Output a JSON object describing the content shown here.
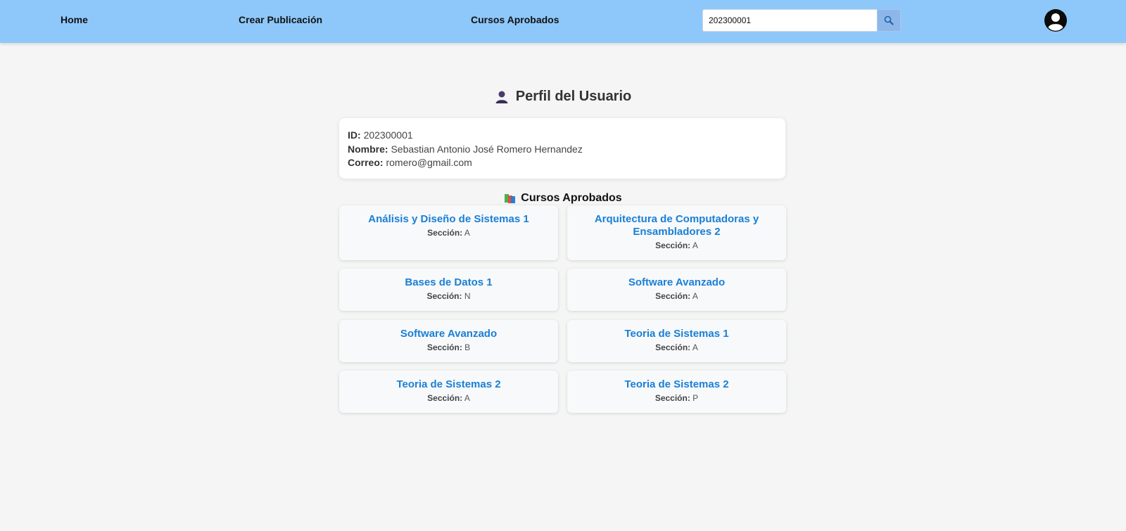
{
  "nav": {
    "home": "Home",
    "create_post": "Crear Publicación",
    "approved_courses": "Cursos Aprobados"
  },
  "search": {
    "value": "202300001",
    "placeholder": "",
    "button_icon": "search-icon"
  },
  "user_menu": {
    "icon": "user-avatar-icon"
  },
  "profile": {
    "title": "Perfil del Usuario",
    "title_icon": "user-silhouette-icon",
    "id_label": "ID:",
    "id_value": "202300001",
    "name_label": "Nombre:",
    "name_value": "Sebastian Antonio José Romero Hernandez",
    "email_label": "Correo:",
    "email_value": "romero@gmail.com"
  },
  "courses": {
    "title": "Cursos Aprobados",
    "title_icon": "books-icon",
    "section_label": "Sección:",
    "items": [
      {
        "name": "Análisis y Diseño de Sistemas 1",
        "section": "A"
      },
      {
        "name": "Arquitectura de Computadoras y Ensambladores 2",
        "section": "A"
      },
      {
        "name": "Bases de Datos 1",
        "section": "N"
      },
      {
        "name": "Software Avanzado",
        "section": "A"
      },
      {
        "name": "Software Avanzado",
        "section": "B"
      },
      {
        "name": "Teoria de Sistemas 1",
        "section": "A"
      },
      {
        "name": "Teoria de Sistemas 2",
        "section": "A"
      },
      {
        "name": "Teoria de Sistemas 2",
        "section": "P"
      }
    ]
  },
  "colors": {
    "navbar": "#8ec8fb",
    "background": "#f4f5f4",
    "course_title": "#1a7fd6",
    "search_button": "#8db7ea"
  }
}
